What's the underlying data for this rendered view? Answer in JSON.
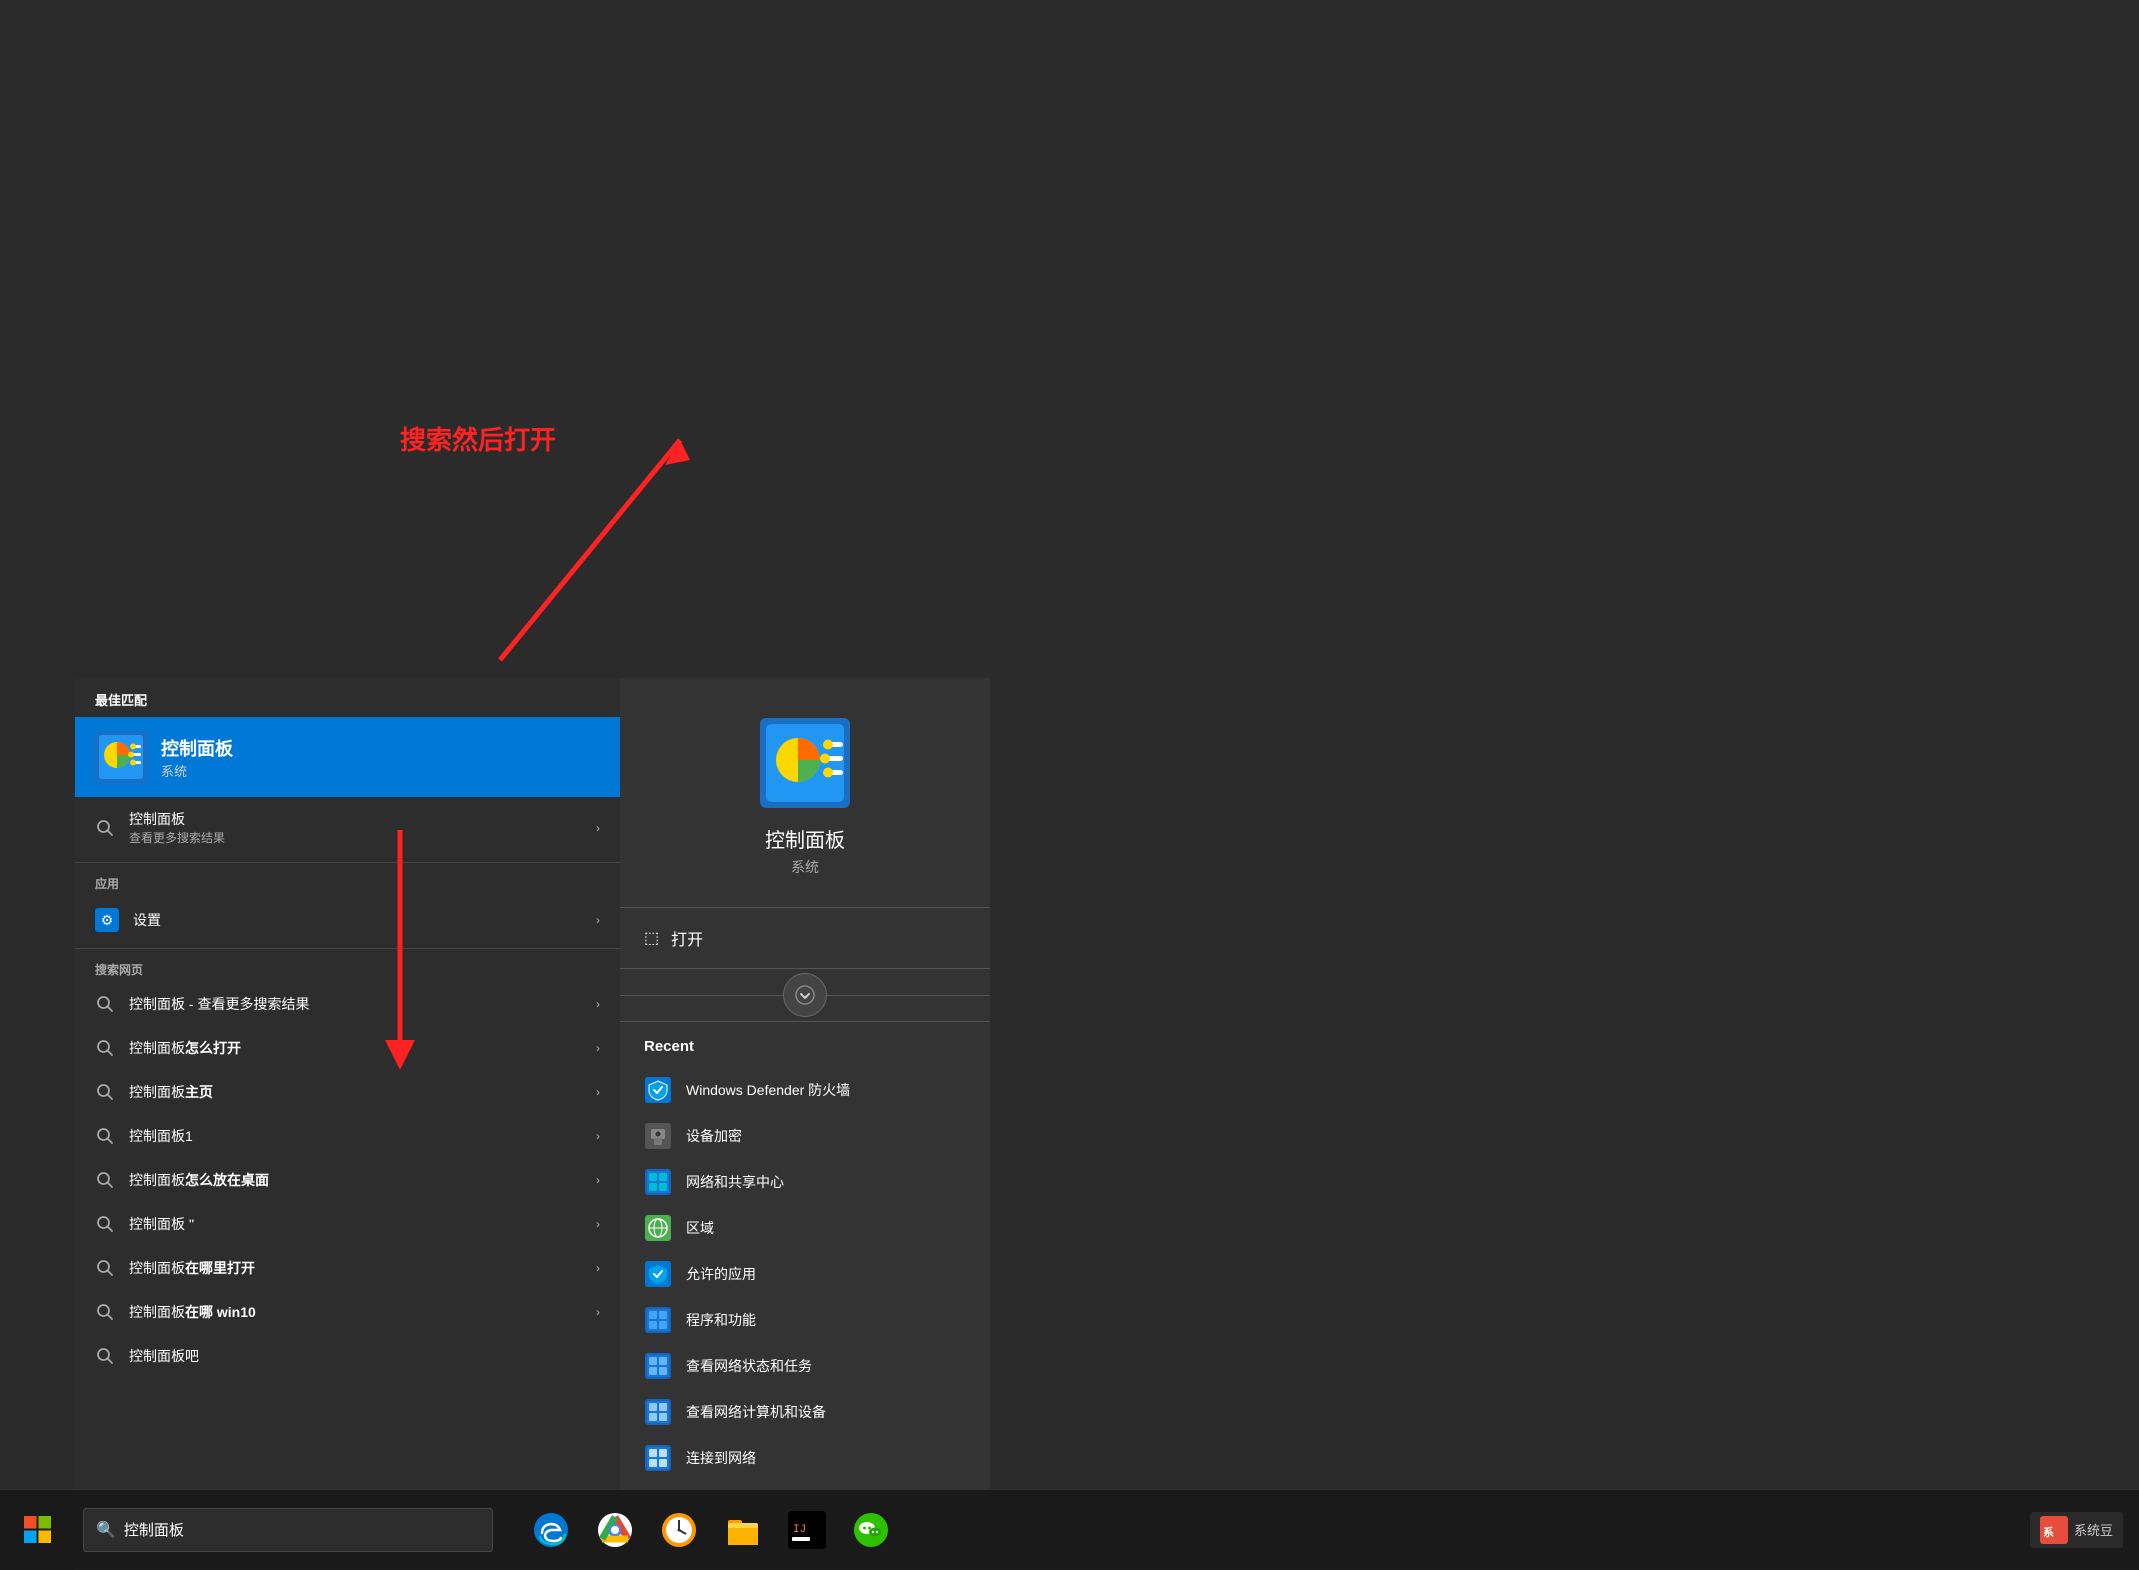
{
  "background": {
    "color": "#2b2b2b"
  },
  "start_menu": {
    "best_match_label": "最佳匹配",
    "best_match_item": {
      "title": "控制面板",
      "subtitle": "系统"
    },
    "search_all_label": "控制面板",
    "search_all_sublabel": "查看更多搜索结果",
    "apps_section_label": "应用",
    "settings_item": "设置",
    "web_search_section_label": "搜索网页",
    "web_items": [
      {
        "text": "控制面板 - 查看更多搜索结果",
        "bold": false
      },
      {
        "text_before": "控制面板",
        "text_bold": "怎么打开",
        "bold": true
      },
      {
        "text_before": "控制面板",
        "text_bold": "主页",
        "bold": true
      },
      {
        "text_before": "控制面板",
        "text_bold": "1",
        "bold": false
      },
      {
        "text_before": "控制面板",
        "text_bold": "怎么放在桌面",
        "bold": true
      },
      {
        "text_before": "控制面板",
        "text_bold": "''",
        "bold": false
      },
      {
        "text_before": "控制面板",
        "text_bold": "在哪里打开",
        "bold": true
      },
      {
        "text_before": "控制面板",
        "text_bold": "在哪 win10",
        "bold": true
      },
      {
        "text_before": "控制面板",
        "text_bold": "吧",
        "bold": false
      }
    ]
  },
  "right_panel": {
    "app_name": "控制面板",
    "app_category": "系统",
    "open_action": "打开",
    "recent_title": "Recent",
    "recent_items": [
      {
        "name": "Windows Defender 防火墙"
      },
      {
        "name": "设备加密"
      },
      {
        "name": "网络和共享中心"
      },
      {
        "name": "区域"
      },
      {
        "name": "允许的应用"
      },
      {
        "name": "程序和功能"
      },
      {
        "name": "查看网络状态和任务"
      },
      {
        "name": "查看网络计算机和设备"
      },
      {
        "name": "连接到网络"
      }
    ]
  },
  "annotation": {
    "text": "搜索然后打开"
  },
  "taskbar": {
    "search_placeholder": "控制面板",
    "search_icon": "🔍"
  }
}
